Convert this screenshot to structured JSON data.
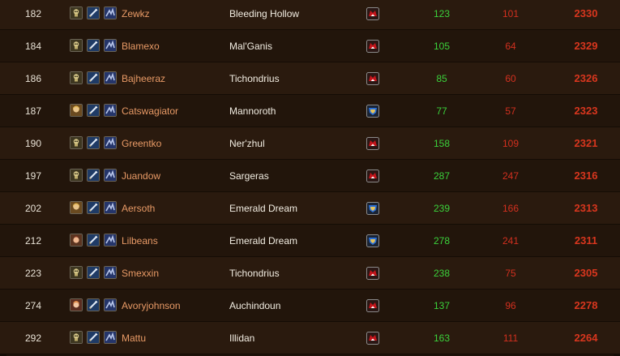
{
  "colors": {
    "wins": "#3bd13b",
    "losses": "#d2301f",
    "rating": "#d8361e",
    "name": "#e89a66",
    "horde": "#c4151b",
    "alliance": "#2b6fd6"
  },
  "rows": [
    {
      "rank": "182",
      "name": "Zewkz",
      "realm": "Bleeding Hollow",
      "faction": "horde",
      "race_icon": "undead-icon",
      "wins": "123",
      "losses": "101",
      "rating": "2330"
    },
    {
      "rank": "184",
      "name": "Blamexo",
      "realm": "Mal'Ganis",
      "faction": "horde",
      "race_icon": "undead-icon",
      "wins": "105",
      "losses": "64",
      "rating": "2329"
    },
    {
      "rank": "186",
      "name": "Bajheeraz",
      "realm": "Tichondrius",
      "faction": "horde",
      "race_icon": "undead-icon",
      "wins": "85",
      "losses": "60",
      "rating": "2326"
    },
    {
      "rank": "187",
      "name": "Catswagiator",
      "realm": "Mannoroth",
      "faction": "alliance",
      "race_icon": "human-icon",
      "wins": "77",
      "losses": "57",
      "rating": "2323"
    },
    {
      "rank": "190",
      "name": "Greentko",
      "realm": "Ner'zhul",
      "faction": "horde",
      "race_icon": "undead-icon",
      "wins": "158",
      "losses": "109",
      "rating": "2321"
    },
    {
      "rank": "197",
      "name": "Juandow",
      "realm": "Sargeras",
      "faction": "horde",
      "race_icon": "undead-icon",
      "wins": "287",
      "losses": "247",
      "rating": "2316"
    },
    {
      "rank": "202",
      "name": "Aersoth",
      "realm": "Emerald Dream",
      "faction": "alliance",
      "race_icon": "human-icon",
      "wins": "239",
      "losses": "166",
      "rating": "2313"
    },
    {
      "rank": "212",
      "name": "Lilbeans",
      "realm": "Emerald Dream",
      "faction": "alliance",
      "race_icon": "gnome-icon",
      "wins": "278",
      "losses": "241",
      "rating": "2311"
    },
    {
      "rank": "223",
      "name": "Smexxin",
      "realm": "Tichondrius",
      "faction": "horde",
      "race_icon": "undead-icon",
      "wins": "238",
      "losses": "75",
      "rating": "2305"
    },
    {
      "rank": "274",
      "name": "Avoryjohnson",
      "realm": "Auchindoun",
      "faction": "horde",
      "race_icon": "blood-elf-icon",
      "wins": "137",
      "losses": "96",
      "rating": "2278"
    },
    {
      "rank": "292",
      "name": "Mattu",
      "realm": "Illidan",
      "faction": "horde",
      "race_icon": "undead-icon",
      "wins": "163",
      "losses": "111",
      "rating": "2264"
    }
  ]
}
